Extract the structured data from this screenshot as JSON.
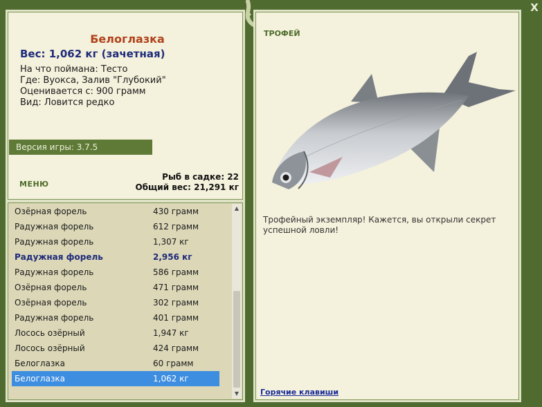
{
  "fish": {
    "name": "Белоглазка",
    "weight": "Вес: 1,062 кг (зачетная)",
    "bait": "На что поймана: Тесто",
    "location": "Где: Вуокса, Залив \"Глубокий\"",
    "valued": "Оценивается с: 900 грамм",
    "kind": "Вид: Ловится редко"
  },
  "version": "Версия игры: 3.7.5",
  "menu_label": "МЕНЮ",
  "stats": {
    "fish_count": "Рыб в садке: 22",
    "total_weight": "Общий вес: 21,291 кг"
  },
  "catch_list": [
    {
      "name": "Озёрная форель",
      "weight": "430 грамм"
    },
    {
      "name": "Радужная форель",
      "weight": "612 грамм"
    },
    {
      "name": "Радужная форель",
      "weight": "1,307 кг"
    },
    {
      "name": "Радужная форель",
      "weight": "2,956 кг"
    },
    {
      "name": "Радужная форель",
      "weight": "586 грамм"
    },
    {
      "name": "Озёрная форель",
      "weight": "471 грамм"
    },
    {
      "name": "Озёрная форель",
      "weight": "302 грамм"
    },
    {
      "name": "Радужная форель",
      "weight": "401 грамм"
    },
    {
      "name": "Лосось озёрный",
      "weight": "1,947 кг"
    },
    {
      "name": "Лосось озёрный",
      "weight": "424 грамм"
    },
    {
      "name": "Белоглазка",
      "weight": "60 грамм"
    },
    {
      "name": "Белоглазка",
      "weight": "1,062 кг"
    }
  ],
  "trophy": {
    "label": "ТРОФЕЙ",
    "text": "Трофейный экземпляр! Кажется, вы открыли секрет успешной ловли!"
  },
  "hotkeys_label": "Горячие клавиши",
  "close_label": "X",
  "icons": {
    "close": "close-icon",
    "lizard": "lizard-icon",
    "fish": "fish-image"
  },
  "colors": {
    "background": "#4f6b30",
    "panel": "#f4f1dc",
    "title": "#b0421b",
    "accent_blue": "#1e2a7a",
    "selection": "#3d8de0",
    "green_label": "#4d6b2a"
  }
}
